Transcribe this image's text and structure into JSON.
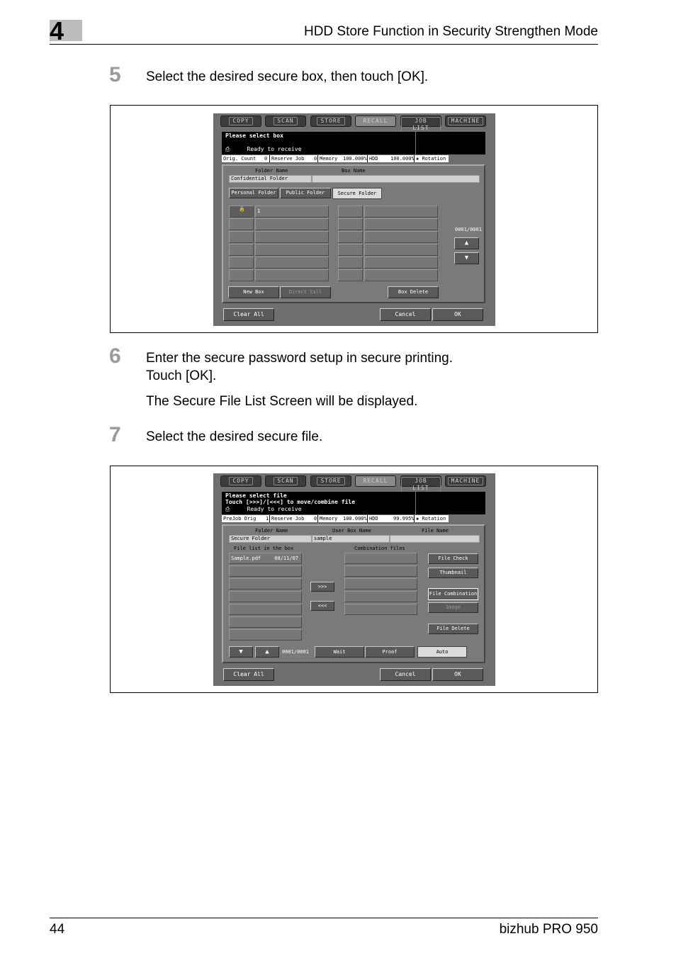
{
  "header": {
    "chapter_number": "4",
    "title": "HDD Store Function in Security Strengthen Mode"
  },
  "steps": [
    {
      "number": "5",
      "lines": [
        "Select the desired secure box, then touch [OK]."
      ]
    },
    {
      "number": "6",
      "lines": [
        "Enter the secure password setup in secure printing.",
        "Touch [OK]."
      ],
      "note": "The Secure File List Screen will be displayed."
    },
    {
      "number": "7",
      "lines": [
        "Select the desired secure file."
      ]
    }
  ],
  "screen1": {
    "tabs": [
      "COPY",
      "SCAN",
      "STORE",
      "RECALL",
      "JOB LIST",
      "MACHINE"
    ],
    "active_tab": "RECALL",
    "message": "Please select box",
    "status_line": "Ready to receive",
    "status_bar": {
      "orig_label": "Orig. Count",
      "orig_value": "0",
      "reserve_label": "Reserve Job",
      "reserve_value": "0",
      "memory_label": "Memory",
      "memory_value": "100.000%",
      "hdd_label": "HDD",
      "hdd_value": "100.000%",
      "rotation_label": "Rotation"
    },
    "folder_name_label": "Folder Name",
    "box_name_label": "Box Name",
    "folder_value": "Confidential Folder",
    "folder_tabs": [
      "Personal Folder",
      "Public Folder",
      "Secure Folder"
    ],
    "box_first": "1",
    "page_counter": "0001/0001",
    "up_arrow": "▲",
    "down_arrow": "▼",
    "buttons": {
      "new_box": "New Box",
      "direct_call": "Direct Call",
      "box_delete": "Box Delete",
      "clear_all": "Clear All",
      "cancel": "Cancel",
      "ok": "OK"
    }
  },
  "screen2": {
    "tabs": [
      "COPY",
      "SCAN",
      "STORE",
      "RECALL",
      "JOB LIST",
      "MACHINE"
    ],
    "active_tab": "RECALL",
    "message_line1": "Please select file",
    "message_line2": "Touch [>>>]/[<<<] to move/combine file",
    "status_line": "Ready to receive",
    "status_bar": {
      "orig_label": "PreJob Orig",
      "orig_value": "1",
      "reserve_label": "Reserve Job",
      "reserve_value": "0",
      "memory_label": "Memory",
      "memory_value": "100.000%",
      "hdd_label": "HDD",
      "hdd_value": "99.995%",
      "rotation_label": "Rotation"
    },
    "folder_name_label": "Folder Name",
    "user_box_label": "User Box Name",
    "file_name_label": "File Name",
    "folder_value": "Secure Folder",
    "box_value": "sample",
    "file_list_label": "File list in the box",
    "combination_label": "Combination files",
    "file_item_name": "Sample.pdf",
    "file_item_date": "08/11/07",
    "move_right": ">>>",
    "move_left": "<<<",
    "page_counter": "0001/0001",
    "down_arrow": "▼",
    "up_arrow": "▲",
    "buttons": {
      "file_check": "File Check",
      "thumbnail": "Thumbnail",
      "file_combination": "File Combination",
      "image": "Image",
      "file_delete": "File Delete",
      "wait": "Wait",
      "proof": "Proof",
      "auto": "Auto",
      "clear_all": "Clear All",
      "cancel": "Cancel",
      "ok": "OK"
    }
  },
  "footer": {
    "page_number": "44",
    "product": "bizhub PRO 950"
  }
}
